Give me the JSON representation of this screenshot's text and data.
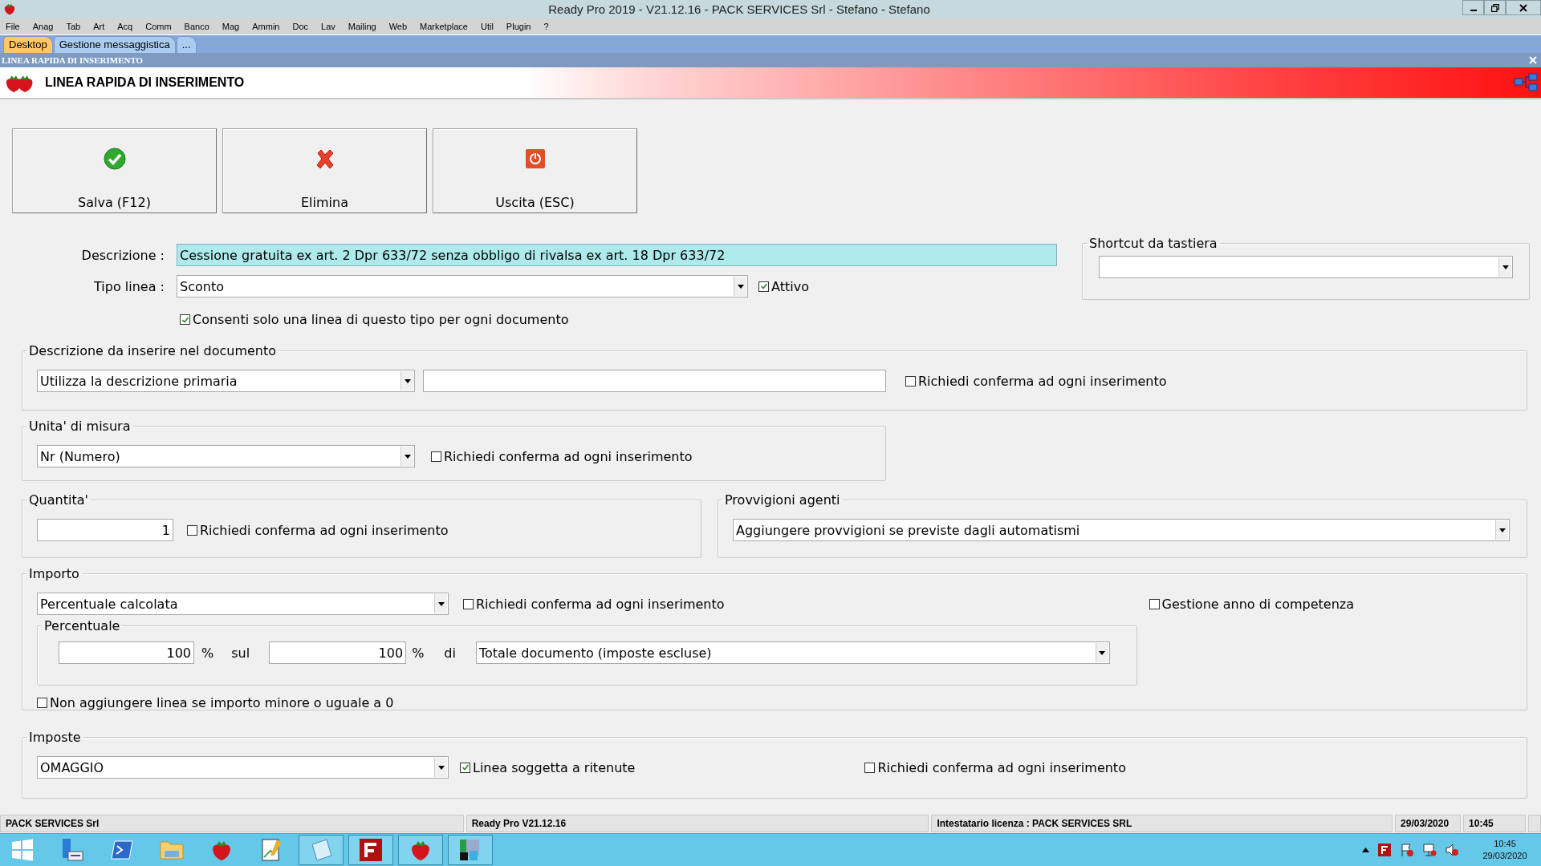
{
  "window": {
    "title": "Ready Pro 2019 - V21.12.16 - PACK SERVICES Srl - Stefano - Stefano"
  },
  "menu": [
    "File",
    "Anag",
    "Tab",
    "Art",
    "Acq",
    "Comm",
    "Banco",
    "Mag",
    "Ammin",
    "Doc",
    "Lav",
    "Mailing",
    "Web",
    "Marketplace",
    "Util",
    "Plugin",
    "?"
  ],
  "tabs": [
    {
      "label": "Desktop",
      "selected": true
    },
    {
      "label": "Gestione messaggistica",
      "selected": false
    },
    {
      "label": "...",
      "selected": false
    }
  ],
  "panel_bar": {
    "title": "LINEA RAPIDA DI INSERIMENTO"
  },
  "header": {
    "title": "LINEA RAPIDA DI INSERIMENTO"
  },
  "toolbar": [
    {
      "label": "Salva (F12)",
      "kind": "save"
    },
    {
      "label": "Elimina",
      "kind": "delete"
    },
    {
      "label": "Uscita (ESC)",
      "kind": "exit"
    }
  ],
  "descrizione": {
    "label": "Descrizione :",
    "value": "Cessione gratuita ex art. 2 Dpr 633/72 senza obbligo di rivalsa ex art. 18 Dpr 633/72"
  },
  "tipo_linea": {
    "label": "Tipo linea :",
    "value": "Sconto"
  },
  "attivo": {
    "label": "Attivo",
    "checked": true
  },
  "consenti": {
    "label": "Consenti solo una linea di questo tipo per ogni documento",
    "checked": true
  },
  "shortcut": {
    "title": "Shortcut da tastiera"
  },
  "descrizione_documento": {
    "title": "Descrizione da inserire nel documento",
    "mode": "Utilizza la descrizione primaria",
    "confirm": {
      "label": "Richiedi conferma ad ogni inserimento",
      "checked": false
    }
  },
  "unita_misura": {
    "title": "Unita' di misura",
    "value": "Nr (Numero)",
    "confirm": {
      "label": "Richiedi conferma ad ogni inserimento",
      "checked": false
    }
  },
  "quantita": {
    "title": "Quantita'",
    "value": "1",
    "confirm": {
      "label": "Richiedi conferma ad ogni inserimento",
      "checked": false
    }
  },
  "provvigioni": {
    "title": "Provvigioni agenti",
    "value": "Aggiungere provvigioni se previste dagli automatismi"
  },
  "importo": {
    "title": "Importo",
    "mode": "Percentuale calcolata",
    "confirm": {
      "label": "Richiedi conferma ad ogni inserimento",
      "checked": false
    },
    "anno_competenza": {
      "label": "Gestione anno di competenza",
      "checked": false
    },
    "percentuale": {
      "title": "Percentuale",
      "value_1": "100",
      "unit_1": "%",
      "sul": "sul",
      "value_2": "100",
      "unit_2": "%",
      "di": "di",
      "base": "Totale documento (imposte escluse)"
    },
    "non_aggiungere": {
      "label": "Non aggiungere linea se importo minore o uguale a 0",
      "checked": false
    }
  },
  "imposte": {
    "title": "Imposte",
    "value": "OMAGGIO",
    "ritenute": {
      "label": "Linea soggetta a ritenute",
      "checked": true
    },
    "confirm": {
      "label": "Richiedi conferma ad ogni inserimento",
      "checked": false
    }
  },
  "status_bar": [
    "PACK SERVICES Srl",
    "Ready Pro V21.12.16",
    "Intestatario licenza : PACK SERVICES SRL",
    "29/03/2020",
    "10:45"
  ],
  "taskbar": {
    "time": "10:45",
    "date": "29/03/2020"
  }
}
